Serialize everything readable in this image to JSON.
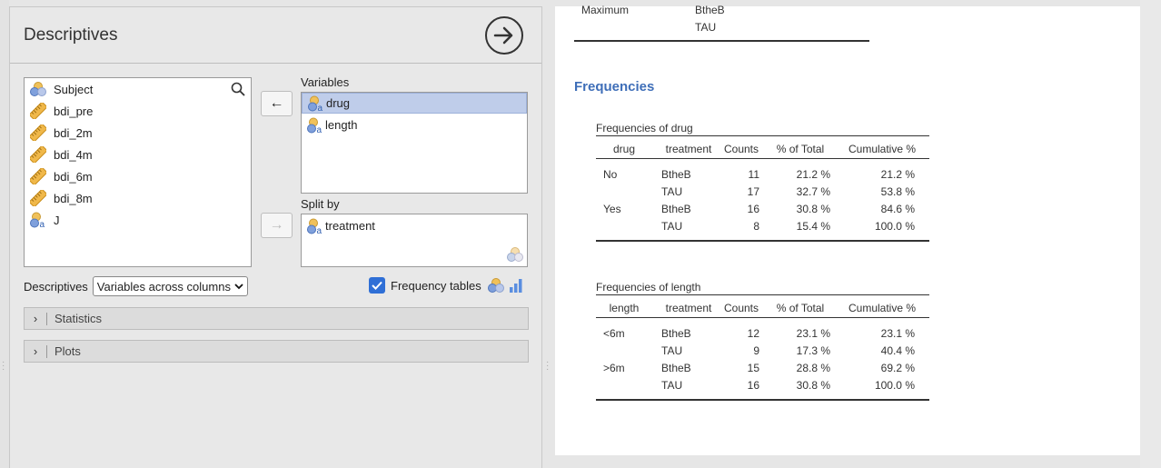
{
  "analysis": {
    "title": "Descriptives",
    "variables_label": "Variables",
    "split_by_label": "Split by",
    "descriptives_label": "Descriptives",
    "descriptives_option": "Variables across columns",
    "frequency_tables_label": "Frequency tables",
    "frequency_tables_checked": true,
    "statistics_label": "Statistics",
    "plots_label": "Plots"
  },
  "source_variables": [
    {
      "name": "Subject",
      "type": "nominal"
    },
    {
      "name": "bdi_pre",
      "type": "continuous"
    },
    {
      "name": "bdi_2m",
      "type": "continuous"
    },
    {
      "name": "bdi_4m",
      "type": "continuous"
    },
    {
      "name": "bdi_6m",
      "type": "continuous"
    },
    {
      "name": "bdi_8m",
      "type": "continuous"
    },
    {
      "name": "J",
      "type": "nominal-text"
    }
  ],
  "selected_variables": [
    {
      "name": "drug",
      "selected": true
    },
    {
      "name": "length",
      "selected": false
    }
  ],
  "split_variables": [
    {
      "name": "treatment"
    }
  ],
  "buttons": {
    "move_left": "←",
    "move_right": "→"
  },
  "results": {
    "top_fragment": {
      "row_label": "Maximum",
      "values": [
        "BtheB",
        "TAU"
      ]
    },
    "section_title": "Frequencies",
    "tables": [
      {
        "caption": "Frequencies of drug",
        "headers": [
          "drug",
          "treatment",
          "Counts",
          "% of Total",
          "Cumulative %"
        ],
        "rows": [
          [
            "No",
            "BtheB",
            "11",
            "21.2 %",
            "21.2 %"
          ],
          [
            "",
            "TAU",
            "17",
            "32.7 %",
            "53.8 %"
          ],
          [
            "Yes",
            "BtheB",
            "16",
            "30.8 %",
            "84.6 %"
          ],
          [
            "",
            "TAU",
            "8",
            "15.4 %",
            "100.0 %"
          ]
        ]
      },
      {
        "caption": "Frequencies of length",
        "headers": [
          "length",
          "treatment",
          "Counts",
          "% of Total",
          "Cumulative %"
        ],
        "rows": [
          [
            "<6m",
            "BtheB",
            "12",
            "23.1 %",
            "23.1 %"
          ],
          [
            "",
            "TAU",
            "9",
            "17.3 %",
            "40.4 %"
          ],
          [
            ">6m",
            "BtheB",
            "15",
            "28.8 %",
            "69.2 %"
          ],
          [
            "",
            "TAU",
            "16",
            "30.8 %",
            "100.0 %"
          ]
        ]
      }
    ]
  },
  "colors": {
    "accent_blue": "#3e6eb8",
    "selection": "#bfcdea",
    "checkbox": "#2f6fd6"
  }
}
